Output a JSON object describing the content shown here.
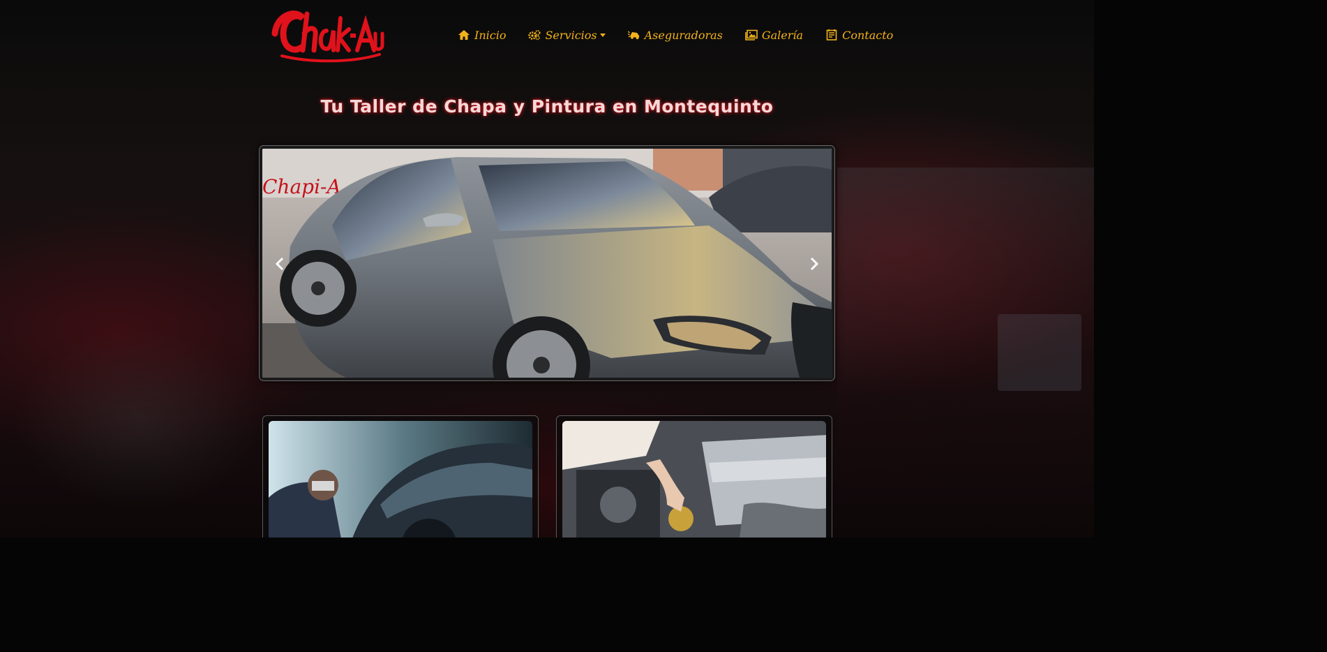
{
  "brand": {
    "logo_text": "Chapi-Auto",
    "accent_color": "#f2b31b",
    "logo_color": "#e0121b"
  },
  "nav": {
    "items": [
      {
        "label": "Inicio",
        "icon": "home-icon"
      },
      {
        "label": "Servicios",
        "icon": "gears-icon",
        "has_dropdown": true
      },
      {
        "label": "Aseguradoras",
        "icon": "car-crash-icon"
      },
      {
        "label": "Galería",
        "icon": "images-icon"
      },
      {
        "label": "Contacto",
        "icon": "contact-card-icon"
      }
    ]
  },
  "hero": {
    "headline": "Tu Taller de Chapa y Pintura en Montequinto"
  },
  "carousel": {
    "prev_icon": "chevron-left-icon",
    "next_icon": "chevron-right-icon",
    "slide_image": "grey-sedan-photo"
  },
  "cards": [
    {
      "image": "car-painting-photo"
    },
    {
      "image": "engine-maintenance-photo"
    }
  ]
}
